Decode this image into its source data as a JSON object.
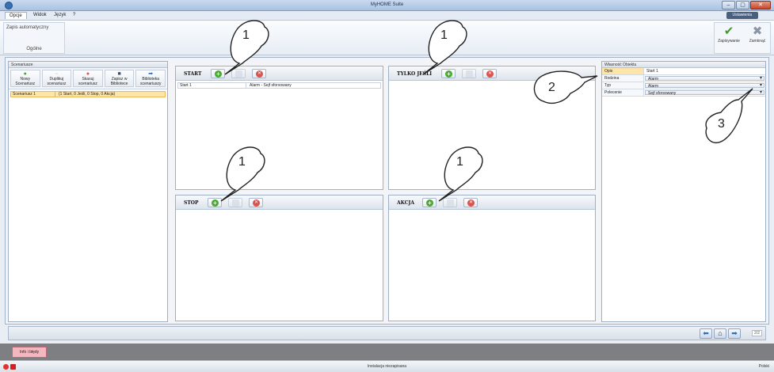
{
  "window": {
    "title": "MyHOME Suite",
    "minimize": "–",
    "maximize": "▢",
    "close": "✕"
  },
  "menu": {
    "items": [
      "Opcje",
      "Widok",
      "Język",
      "?"
    ],
    "lang_badge": "Ustawienia"
  },
  "ribbon": {
    "autosave_label": "Zapis automatyczny",
    "group_label": "Ogólne",
    "save_label": "Zapisywanie",
    "close_label": "Zamknąć"
  },
  "scenarios": {
    "panel_title": "Scenariusze",
    "toolbar": [
      {
        "label": "Nowy Scenariusz",
        "icon": "add-icon"
      },
      {
        "label": "Duplikuj scenariusz",
        "icon": "duplicate-icon"
      },
      {
        "label": "Skasuj scenariusz",
        "icon": "delete-icon"
      },
      {
        "label": "Zapisz w Bibliotece",
        "icon": "save-icon"
      },
      {
        "label": "Biblioteka scenariuszy",
        "icon": "library-icon"
      }
    ],
    "list": [
      {
        "name": "Scenariusz 1",
        "summary": "(1 Start, 0 Jeśli, 0 Stop, 0 Akcja)"
      }
    ]
  },
  "sections": {
    "start": {
      "title": "START",
      "rows": [
        {
          "name": "Start 1",
          "desc": "Alarm - Sejf sforsowany"
        }
      ]
    },
    "tylko_jesli": {
      "title": "TYLKO JEŚLI"
    },
    "stop": {
      "title": "STOP"
    },
    "akcja": {
      "title": "AKCJA"
    }
  },
  "properties": {
    "panel_title": "Własność Obiektu",
    "rows": [
      {
        "key": "Opis",
        "value": "Start 1"
      },
      {
        "key": "Rodzina",
        "value": "Alarm"
      },
      {
        "key": "Typ",
        "value": "Alarm"
      },
      {
        "key": "Polecenie",
        "value": "Sejf sforsowany"
      }
    ]
  },
  "nav": {
    "page": "2/2"
  },
  "bottom_tab": "Info i błędy",
  "status": {
    "message": "Instalacja niezapisana",
    "language": "Polski"
  },
  "callouts": [
    "1",
    "1",
    "1",
    "1",
    "2",
    "3"
  ],
  "colors": {
    "add": "#49a832",
    "delete": "#d9534f",
    "selected_row": "#fde4a8",
    "info_tab": "#f3b8bf"
  }
}
